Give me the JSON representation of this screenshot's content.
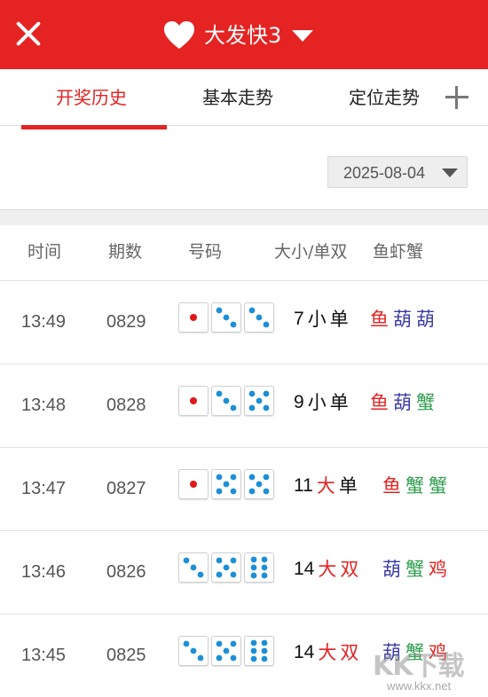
{
  "header": {
    "title": "大发快3",
    "close_icon": "close-icon",
    "favorite_icon": "heart-icon",
    "dropdown_icon": "caret-down-icon",
    "bg_color": "#e52323"
  },
  "tabs": [
    {
      "label": "开奖历史",
      "active": true
    },
    {
      "label": "基本走势",
      "active": false
    },
    {
      "label": "定位走势",
      "active": false
    }
  ],
  "add_tab_icon": "plus-icon",
  "date_picker": {
    "value": "2025-08-04",
    "icon": "caret-down-icon"
  },
  "columns": {
    "time": "时间",
    "issue": "期数",
    "numbers": "号码",
    "size_parity": "大小/单双",
    "fish_shrimp_crab": "鱼虾蟹"
  },
  "rows": [
    {
      "time": "13:49",
      "issue": "0829",
      "dice": [
        1,
        3,
        3
      ],
      "sum": "7",
      "size": "小",
      "parity": "单",
      "symbols": [
        "鱼",
        "葫",
        "葫"
      ]
    },
    {
      "time": "13:48",
      "issue": "0828",
      "dice": [
        1,
        3,
        5
      ],
      "sum": "9",
      "size": "小",
      "parity": "单",
      "symbols": [
        "鱼",
        "葫",
        "蟹"
      ]
    },
    {
      "time": "13:47",
      "issue": "0827",
      "dice": [
        1,
        5,
        5
      ],
      "sum": "11",
      "size": "大",
      "parity": "单",
      "symbols": [
        "鱼",
        "蟹",
        "蟹"
      ]
    },
    {
      "time": "13:46",
      "issue": "0826",
      "dice": [
        3,
        5,
        6
      ],
      "sum": "14",
      "size": "大",
      "parity": "双",
      "symbols": [
        "葫",
        "蟹",
        "鸡"
      ]
    },
    {
      "time": "13:45",
      "issue": "0825",
      "dice": [
        3,
        5,
        6
      ],
      "sum": "14",
      "size": "大",
      "parity": "双",
      "symbols": [
        "葫",
        "蟹",
        "鸡"
      ]
    }
  ],
  "watermark": {
    "text": "KK下载",
    "url": "www.kkx.net"
  }
}
